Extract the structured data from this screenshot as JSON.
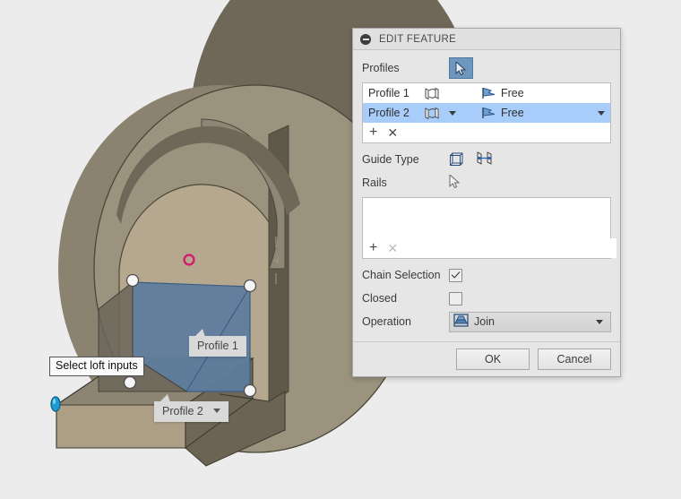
{
  "app": {
    "viewport_background": "#ececec"
  },
  "viewport": {
    "callouts": [
      {
        "name": "profile-1",
        "label": "Profile 1",
        "has_dropdown": false
      },
      {
        "name": "profile-2",
        "label": "Profile 2",
        "has_dropdown": true
      }
    ],
    "tooltip": {
      "text": "Select loft inputs"
    },
    "markers": {
      "origin_point_color": "#d4196e",
      "handle_color": "#1e9bd0",
      "profile_face_color": "#5c7c9e",
      "body_color": "#b0a48d"
    }
  },
  "dialog": {
    "title": "EDIT FEATURE",
    "collapse_icon": "minus-circle-icon",
    "profiles": {
      "label": "Profiles",
      "select_button_icon": "cursor-arrow-icon",
      "rows": [
        {
          "name": "Profile 1",
          "shape_icon": "profile-loop-icon",
          "condition": "Free",
          "condition_icon": "tangent-flag-icon",
          "selected": false
        },
        {
          "name": "Profile 2",
          "shape_icon": "profile-loop-icon",
          "condition": "Free",
          "condition_icon": "tangent-flag-icon",
          "selected": true
        }
      ],
      "add_label": "+",
      "remove_label": "✕"
    },
    "guide_type": {
      "label": "Guide Type",
      "options": [
        {
          "name": "rails-guide-icon",
          "selected": true
        },
        {
          "name": "centerline-guide-icon",
          "selected": false
        }
      ]
    },
    "rails": {
      "label": "Rails",
      "items": [],
      "add_label": "+",
      "remove_label": "✕"
    },
    "chain_selection": {
      "label": "Chain Selection",
      "checked": true
    },
    "closed": {
      "label": "Closed",
      "checked": false
    },
    "operation": {
      "label": "Operation",
      "value": "Join",
      "icon": "join-boolean-icon"
    },
    "footer": {
      "ok_label": "OK",
      "cancel_label": "Cancel"
    }
  }
}
